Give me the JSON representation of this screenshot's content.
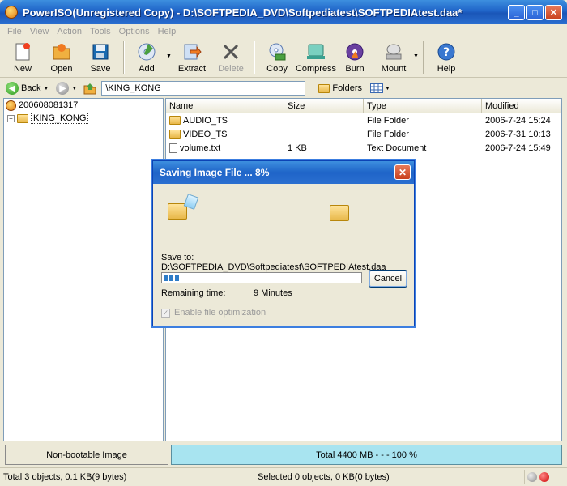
{
  "window": {
    "title": "PowerISO(Unregistered Copy) - D:\\SOFTPEDIA_DVD\\Softpediatest\\SOFTPEDIAtest.daa*",
    "minimize": "_",
    "maximize": "□",
    "close": "✕"
  },
  "menu": [
    "File",
    "View",
    "Action",
    "Tools",
    "Options",
    "Help"
  ],
  "toolbar": {
    "new": "New",
    "open": "Open",
    "save": "Save",
    "add": "Add",
    "extract": "Extract",
    "delete": "Delete",
    "copy": "Copy",
    "compress": "Compress",
    "burn": "Burn",
    "mount": "Mount",
    "help": "Help"
  },
  "address": {
    "back": "Back",
    "path": "\\KING_KONG",
    "folders": "Folders"
  },
  "tree": {
    "root": "200608081317",
    "child": "KING_KONG"
  },
  "list": {
    "columns": [
      "Name",
      "Size",
      "Type",
      "Modified"
    ],
    "rows": [
      {
        "name": "AUDIO_TS",
        "size": "",
        "type": "File Folder",
        "modified": "2006-7-24 15:24"
      },
      {
        "name": "VIDEO_TS",
        "size": "",
        "type": "File Folder",
        "modified": "2006-7-31 10:13"
      },
      {
        "name": "volume.txt",
        "size": "1 KB",
        "type": "Text Document",
        "modified": "2006-7-24 15:49"
      }
    ]
  },
  "dialog": {
    "title": "Saving Image File ...  8%",
    "close": "✕",
    "save_to": "Save to: D:\\SOFTPEDIA_DVD\\Softpediatest\\SOFTPEDIAtest.daa",
    "progress": 0.08,
    "remaining_label": "Remaining time:",
    "remaining_value": "9 Minutes",
    "cancel": "Cancel",
    "option": "Enable file optimization"
  },
  "status": {
    "boot": "Non-bootable Image",
    "total": "Total  4400 MB   - - -  100 %",
    "left": "Total 3 objects, 0.1 KB(9 bytes)",
    "right": "Selected 0 objects, 0 KB(0 bytes)"
  },
  "colors": {
    "accent": "#1f64c8",
    "progress": "#2e7cc7",
    "total_bar": "#a8e4f0"
  }
}
